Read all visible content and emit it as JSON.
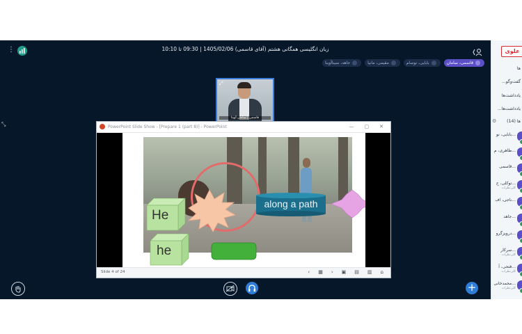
{
  "header": {
    "title": "زبان انگلیسی همگانی هشتم (آقای قاسمی) 1405/02/06 | 09:30 تا 10:10"
  },
  "breakout_pills": [
    {
      "label": "قاسمی، سامان",
      "active": true
    },
    {
      "label": "بابایی، نوسام",
      "active": false
    },
    {
      "label": "مقیمی، مانیا",
      "active": false
    },
    {
      "label": "جاهد، سینا‌آوینا",
      "active": false
    }
  ],
  "webcam": {
    "name": "قاسمی | سامان آوینا"
  },
  "ppt": {
    "window_title": "PowerPoint Slide Show - [Prepare 1 (part 8)] - PowerPoint",
    "status": "Slide 4 of 24",
    "slide_texts": {
      "he_upper": "He",
      "he_lower": "he",
      "phrase": "along a path"
    }
  },
  "sidebar": {
    "logo": "علوی",
    "rows": [
      "ها",
      "گفت‌وگو...",
      "یادداشت‌ها",
      "یادداشت‌ها...",
      "ها (14)"
    ],
    "users": [
      {
        "name": "بابایی، نو...",
        "sub": ""
      },
      {
        "name": "طاهری، م...",
        "sub": ""
      },
      {
        "name": "قاسمی...",
        "sub": ""
      },
      {
        "name": "توکلی، ح...",
        "sub": "کلی‌نظرات"
      },
      {
        "name": "ناجی، اف...",
        "sub": ""
      },
      {
        "name": "جاهد...",
        "sub": ""
      },
      {
        "name": "درویزگرو...",
        "sub": ""
      },
      {
        "name": "سرکار...",
        "sub": "کلی‌نظرات"
      },
      {
        "name": "فتحی، آ...",
        "sub": "کلی‌نظرات"
      },
      {
        "name": "محمدخانی...",
        "sub": "کلی‌نظرات"
      }
    ]
  },
  "colors": {
    "background": "#06172a",
    "accent": "#2f7dd6",
    "active_pill": "#5b4fc7"
  }
}
